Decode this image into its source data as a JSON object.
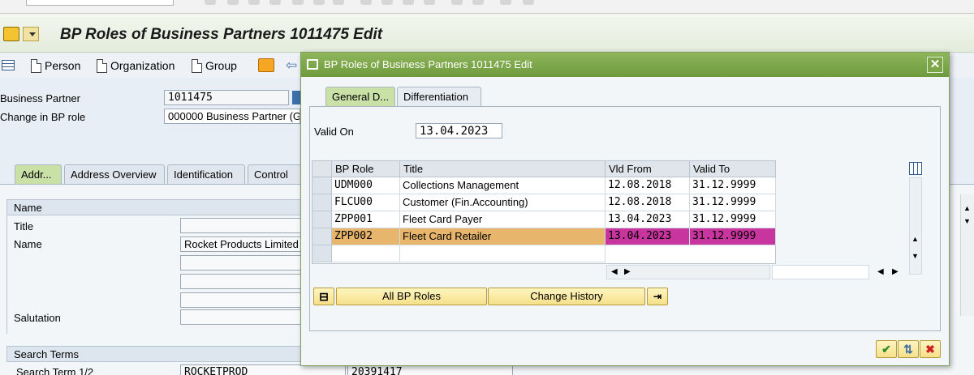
{
  "window": {
    "title": "BP Roles of Business Partners 1011475 Edit"
  },
  "toolbar": {
    "person_label": "Person",
    "organization_label": "Organization",
    "group_label": "Group"
  },
  "header": {
    "bp_label": "Business Partner",
    "bp_value": "1011475",
    "change_role_label": "Change in BP role",
    "change_role_value": "000000 Business Partner (G"
  },
  "main_tabs": [
    "Addr...",
    "Address Overview",
    "Identification",
    "Control"
  ],
  "name_group": {
    "heading": "Name",
    "title_label": "Title",
    "name_label": "Name",
    "name_value": "Rocket Products Limited",
    "salutation_label": "Salutation"
  },
  "search_group": {
    "heading": "Search Terms",
    "term_label": "Search Term 1/2",
    "term1": "ROCKETPROD",
    "term2": "20391417"
  },
  "dialog": {
    "title": "BP Roles of Business Partners 1011475 Edit",
    "tabs": [
      "General D...",
      "Differentiation"
    ],
    "valid_on_label": "Valid On",
    "valid_on_value": "13.04.2023",
    "grid": {
      "headers": [
        "BP Role",
        "Title",
        "Vld From",
        "Valid To"
      ],
      "rows": [
        {
          "role": "UDM000",
          "title": "Collections Management",
          "from": "12.08.2018",
          "to": "31.12.9999"
        },
        {
          "role": "FLCU00",
          "title": "Customer (Fin.Accounting)",
          "from": "12.08.2018",
          "to": "31.12.9999"
        },
        {
          "role": "ZPP001",
          "title": "Fleet Card Payer",
          "from": "13.04.2023",
          "to": "31.12.9999"
        },
        {
          "role": "ZPP002",
          "title": "Fleet Card Retailer",
          "from": "13.04.2023",
          "to": "31.12.9999"
        }
      ]
    },
    "all_roles_label": "All BP Roles",
    "change_history_label": "Change History"
  },
  "colors": {
    "dialog_title": "#7aa546",
    "row_highlight": "#e7b56c",
    "date_highlight": "#c8359e"
  }
}
